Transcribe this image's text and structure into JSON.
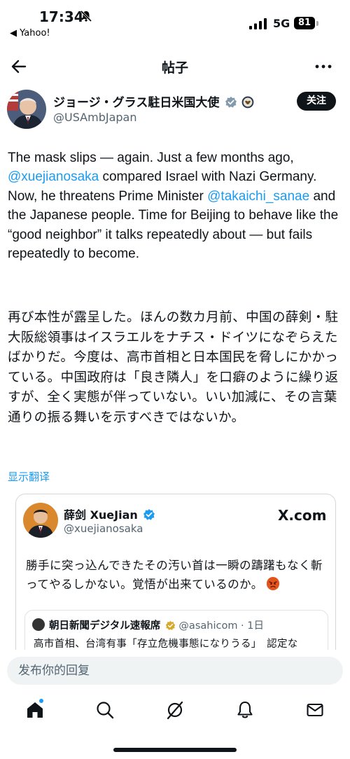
{
  "status_bar": {
    "time": "17:34",
    "back_app": "◀ Yahoo!",
    "network": "5G",
    "battery": "81"
  },
  "nav": {
    "title": "帖子"
  },
  "author": {
    "name": "ジョージ・グラス駐日米国大使",
    "handle": "@USAmbJapan",
    "follow_label": "关注"
  },
  "post": {
    "en_parts": [
      "The mask slips — again. Just a few months ago, ",
      "@xuejianosaka",
      " compared Israel with Nazi Germany. Now, he threatens Prime Minister ",
      "@takaichi_sanae",
      " and the Japanese people. Time for Beijing to behave like the “good neighbor” it talks repeatedly about — but fails repeatedly to become."
    ],
    "jp": "再び本性が露呈した。ほんの数カ月前、中国の薛剣・駐大阪総領事はイスラエルをナチス・ドイツになぞらえたばかりだ。今度は、高市首相と日本国民を脅しにかかっている。中国政府は「良き隣人」を口癖のように繰り返すが、全く実態が伴っていない。いい加減に、その言葉通りの振る舞いを示すべきではないか。",
    "translate_label": "显示翻译"
  },
  "embed": {
    "name": "薛剑 XueJian",
    "handle": "@xuejianosaka",
    "site": "X.com",
    "text": "勝手に突っ込んできたその汚い首は一瞬の躊躇もなく斬ってやるしかない。覚悟が出来ているのか。",
    "quote_source": "朝日新聞デジタル速報席",
    "quote_meta": " @asahicom · 1日",
    "quote_text": "高市首相、台湾有事「存立危機事態になりうる」　認定な"
  },
  "reply": {
    "placeholder": "发布你的回复"
  },
  "colors": {
    "accent": "#1d9bf0",
    "text": "#0f1419",
    "muted": "#536471"
  },
  "icons": [
    "back-arrow-icon",
    "more-icon",
    "verified-badge-icon",
    "seal-icon",
    "home-icon",
    "search-icon",
    "grok-icon",
    "bell-icon",
    "mail-icon"
  ]
}
